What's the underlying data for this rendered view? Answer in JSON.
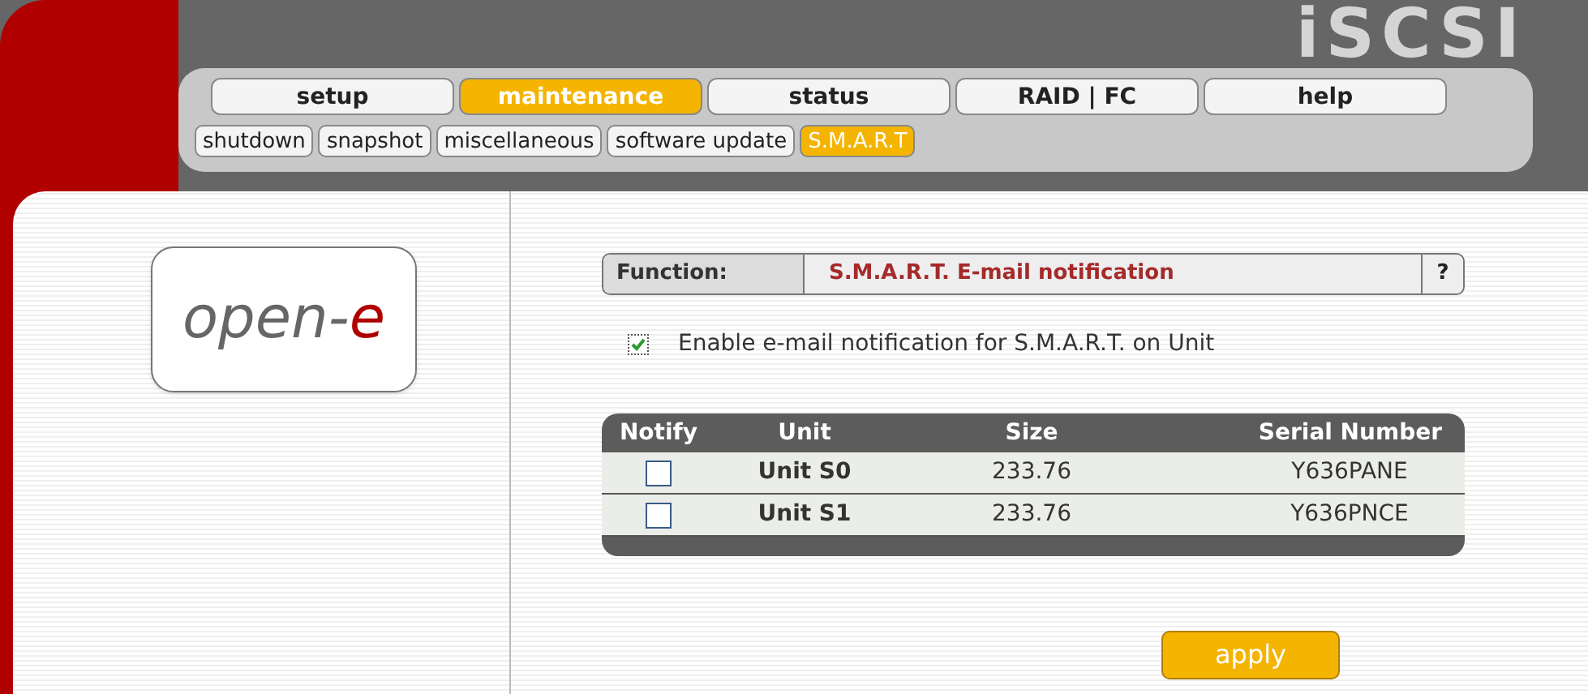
{
  "logo": "iSCSI",
  "tabs": [
    {
      "label": "setup",
      "selected": false
    },
    {
      "label": "maintenance",
      "selected": true
    },
    {
      "label": "status",
      "selected": false
    },
    {
      "label": "RAID | FC",
      "selected": false
    },
    {
      "label": "help",
      "selected": false
    }
  ],
  "subtabs": [
    {
      "label": "shutdown",
      "selected": false
    },
    {
      "label": "snapshot",
      "selected": false
    },
    {
      "label": "miscellaneous",
      "selected": false
    },
    {
      "label": "software update",
      "selected": false
    },
    {
      "label": "S.M.A.R.T",
      "selected": true
    }
  ],
  "brand": {
    "text": "open-",
    "accent": "e"
  },
  "function": {
    "label": "Function:",
    "value": "S.M.A.R.T. E-mail notification",
    "help": "?"
  },
  "enable": {
    "label": "Enable e-mail notification for S.M.A.R.T. on Unit",
    "checked": true
  },
  "table": {
    "columns": [
      "Notify",
      "Unit",
      "Size",
      "Serial Number"
    ],
    "rows": [
      {
        "checked": false,
        "unit": "Unit S0",
        "size": "233.76",
        "serial": "Y636PANE"
      },
      {
        "checked": false,
        "unit": "Unit S1",
        "size": "233.76",
        "serial": "Y636PNCE"
      }
    ]
  },
  "apply": "apply"
}
